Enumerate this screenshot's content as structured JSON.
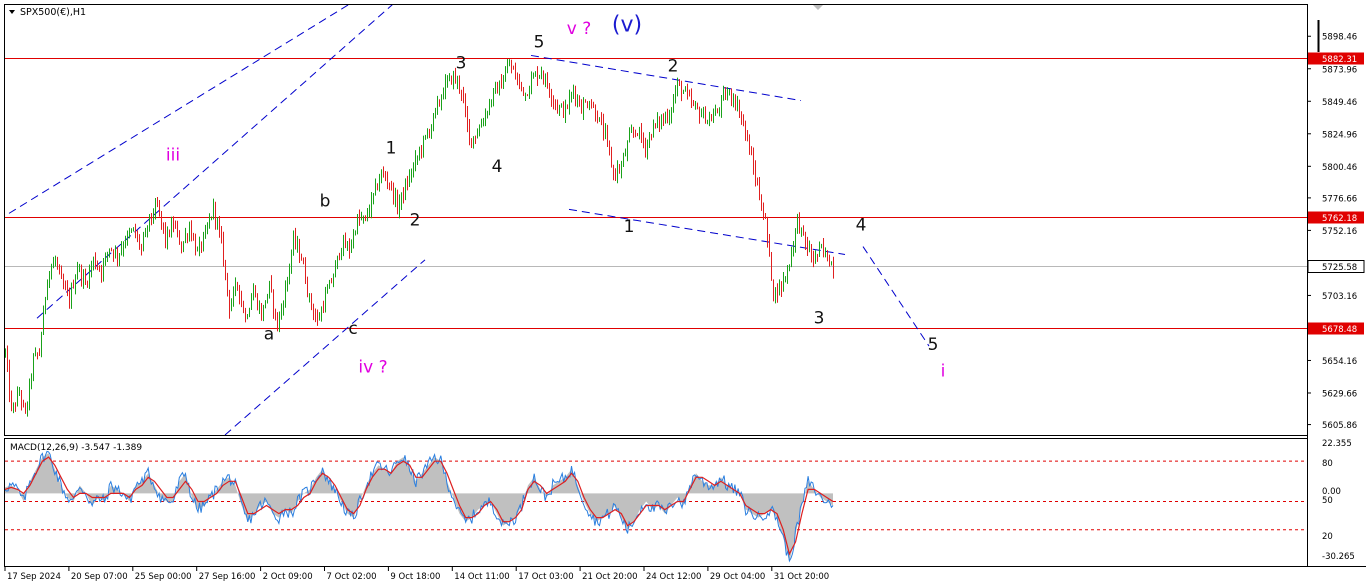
{
  "window": {
    "title": "SPX500(€),H1"
  },
  "macd": {
    "label": "MACD(12,26,9) -3.547 -1.389"
  },
  "colors": {
    "bull": "#1aa21a",
    "bear": "#e02020",
    "hline": "#e00000",
    "trend": "#0000cc",
    "label_black": "#111111",
    "label_magenta": "#e000e0",
    "label_blue": "#1a1ad0",
    "macd_hist": "#c0c0c0",
    "macd_line": "#2a7fe0",
    "macd_signal": "#dd2020",
    "price_tag_bg": "#dddddd"
  },
  "chart_data": [
    {
      "type": "candlestick",
      "title": "SPX500(€),H1",
      "ylim": [
        5598,
        5922
      ],
      "price_ticks": [
        "5898.46",
        "5873.96",
        "5849.46",
        "5824.96",
        "5800.46",
        "5776.66",
        "5752.16",
        "5725.58",
        "5703.16",
        "5678.48",
        "5654.16",
        "5629.66",
        "5605.86"
      ],
      "time_ticks": [
        "17 Sep 2024",
        "20 Sep 07:00",
        "25 Sep 00:00",
        "27 Sep 16:00",
        "2 Oct 09:00",
        "7 Oct 02:00",
        "9 Oct 18:00",
        "14 Oct 11:00",
        "17 Oct 03:00",
        "21 Oct 20:00",
        "24 Oct 12:00",
        "29 Oct 04:00",
        "31 Oct 20:00"
      ],
      "price_axis_labels": [
        "5898.46",
        "5873.96",
        "5849.46",
        "5824.96",
        "5800.46",
        "5776.66",
        "5752.16",
        "5703.16",
        "5654.16",
        "5629.66",
        "5605.86"
      ],
      "horizontal_levels": [
        {
          "price": 5882.31,
          "label": "5882.31"
        },
        {
          "price": 5762.18,
          "label": "5762.18"
        },
        {
          "price": 5678.48,
          "label": "5678.48"
        }
      ],
      "current_price": {
        "price": 5725.58,
        "label": "5725.58"
      },
      "price_path": [
        [
          0,
          5660
        ],
        [
          3,
          5615
        ],
        [
          7,
          5630
        ],
        [
          10,
          5612
        ],
        [
          14,
          5655
        ],
        [
          17,
          5660
        ],
        [
          21,
          5718
        ],
        [
          25,
          5730
        ],
        [
          28,
          5712
        ],
        [
          32,
          5700
        ],
        [
          36,
          5725
        ],
        [
          40,
          5712
        ],
        [
          44,
          5730
        ],
        [
          48,
          5722
        ],
        [
          52,
          5740
        ],
        [
          56,
          5733
        ],
        [
          60,
          5746
        ],
        [
          64,
          5752
        ],
        [
          68,
          5738
        ],
        [
          72,
          5760
        ],
        [
          76,
          5770
        ],
        [
          80,
          5745
        ],
        [
          84,
          5757
        ],
        [
          88,
          5740
        ],
        [
          92,
          5755
        ],
        [
          96,
          5735
        ],
        [
          100,
          5748
        ],
        [
          104,
          5770
        ],
        [
          108,
          5742
        ],
        [
          112,
          5695
        ],
        [
          116,
          5712
        ],
        [
          120,
          5686
        ],
        [
          124,
          5707
        ],
        [
          128,
          5688
        ],
        [
          132,
          5710
        ],
        [
          136,
          5680
        ],
        [
          140,
          5707
        ],
        [
          144,
          5745
        ],
        [
          148,
          5732
        ],
        [
          152,
          5700
        ],
        [
          156,
          5683
        ],
        [
          160,
          5702
        ],
        [
          164,
          5718
        ],
        [
          168,
          5742
        ],
        [
          172,
          5738
        ],
        [
          176,
          5760
        ],
        [
          180,
          5760
        ],
        [
          184,
          5778
        ],
        [
          188,
          5795
        ],
        [
          192,
          5788
        ],
        [
          196,
          5770
        ],
        [
          200,
          5784
        ],
        [
          204,
          5800
        ],
        [
          208,
          5815
        ],
        [
          212,
          5828
        ],
        [
          216,
          5845
        ],
        [
          220,
          5862
        ],
        [
          224,
          5868
        ],
        [
          228,
          5858
        ],
        [
          232,
          5820
        ],
        [
          236,
          5826
        ],
        [
          240,
          5840
        ],
        [
          244,
          5855
        ],
        [
          248,
          5863
        ],
        [
          252,
          5878
        ],
        [
          256,
          5865
        ],
        [
          260,
          5855
        ],
        [
          264,
          5868
        ],
        [
          268,
          5872
        ],
        [
          272,
          5858
        ],
        [
          276,
          5845
        ],
        [
          280,
          5842
        ],
        [
          284,
          5858
        ],
        [
          288,
          5845
        ],
        [
          292,
          5850
        ],
        [
          296,
          5838
        ],
        [
          300,
          5823
        ],
        [
          304,
          5795
        ],
        [
          308,
          5800
        ],
        [
          312,
          5822
        ],
        [
          316,
          5828
        ],
        [
          320,
          5815
        ],
        [
          324,
          5830
        ],
        [
          328,
          5835
        ],
        [
          332,
          5840
        ],
        [
          336,
          5862
        ],
        [
          340,
          5855
        ],
        [
          344,
          5845
        ],
        [
          348,
          5840
        ],
        [
          352,
          5835
        ],
        [
          356,
          5842
        ],
        [
          360,
          5855
        ],
        [
          364,
          5853
        ],
        [
          368,
          5838
        ],
        [
          372,
          5813
        ],
        [
          376,
          5785
        ],
        [
          380,
          5758
        ],
        [
          384,
          5705
        ],
        [
          388,
          5710
        ],
        [
          392,
          5728
        ],
        [
          396,
          5760
        ],
        [
          400,
          5742
        ],
        [
          404,
          5730
        ],
        [
          408,
          5738
        ],
        [
          412,
          5730
        ],
        [
          414,
          5725
        ]
      ],
      "trendlines": [
        {
          "from": [
            2,
            5765
          ],
          "to": [
            178,
            5928
          ]
        },
        {
          "from": [
            16,
            5686
          ],
          "to": [
            198,
            5928
          ]
        },
        {
          "from": [
            110,
            5598
          ],
          "to": [
            210,
            5730
          ]
        },
        {
          "from": [
            263,
            5884
          ],
          "to": [
            398,
            5850
          ]
        },
        {
          "from": [
            282,
            5768
          ],
          "to": [
            420,
            5734
          ]
        }
      ],
      "projection": [
        [
          429,
          5740
        ],
        [
          462,
          5665
        ]
      ],
      "wave_labels": [
        {
          "text": "iii",
          "bar": 84,
          "price": 5805,
          "color": "magenta"
        },
        {
          "text": "iv ?",
          "bar": 184,
          "price": 5645,
          "color": "magenta"
        },
        {
          "text": "v ?",
          "bar": 287,
          "price": 5900,
          "color": "magenta"
        },
        {
          "text": "(v)",
          "bar": 311,
          "price": 5902,
          "color": "blue"
        },
        {
          "text": "i",
          "bar": 469,
          "price": 5642,
          "color": "magenta"
        },
        {
          "text": "a",
          "bar": 132,
          "price": 5670,
          "color": "black"
        },
        {
          "text": "b",
          "bar": 160,
          "price": 5770,
          "color": "black"
        },
        {
          "text": "c",
          "bar": 174,
          "price": 5674,
          "color": "black"
        },
        {
          "text": "1",
          "bar": 193,
          "price": 5810,
          "color": "black"
        },
        {
          "text": "2",
          "bar": 205,
          "price": 5756,
          "color": "black"
        },
        {
          "text": "3",
          "bar": 228,
          "price": 5874,
          "color": "black"
        },
        {
          "text": "4",
          "bar": 246,
          "price": 5796,
          "color": "black"
        },
        {
          "text": "5",
          "bar": 267,
          "price": 5890,
          "color": "black"
        },
        {
          "text": "1",
          "bar": 312,
          "price": 5751,
          "color": "black"
        },
        {
          "text": "2",
          "bar": 334,
          "price": 5872,
          "color": "black"
        },
        {
          "text": "3",
          "bar": 407,
          "price": 5682,
          "color": "black"
        },
        {
          "text": "4",
          "bar": 428,
          "price": 5752,
          "color": "black"
        },
        {
          "text": "5",
          "bar": 464,
          "price": 5662,
          "color": "black"
        }
      ]
    },
    {
      "type": "line",
      "title": "MACD(12,26,9) -3.547 -1.389",
      "ylim": [
        -36,
        27
      ],
      "level_labels": [
        "22.355",
        "80",
        "0.00",
        "50",
        "20",
        "-30.265"
      ],
      "dashed_levels": [
        16,
        -4,
        -18
      ],
      "series": [
        {
          "name": "MACD",
          "values": [
            3,
            4,
            2,
            -4,
            6,
            12,
            18,
            20,
            12,
            4,
            -2,
            -4,
            4,
            0,
            -6,
            -2,
            -4,
            4,
            2,
            0,
            -4,
            4,
            6,
            10,
            4,
            -2,
            -4,
            -4,
            6,
            10,
            -2,
            -8,
            -6,
            -2,
            2,
            6,
            8,
            4,
            -6,
            -14,
            -10,
            -6,
            -4,
            -10,
            -12,
            -8,
            -10,
            -4,
            0,
            2,
            8,
            12,
            6,
            2,
            -4,
            -10,
            -12,
            -4,
            4,
            10,
            14,
            12,
            10,
            16,
            18,
            12,
            6,
            10,
            14,
            18,
            16,
            6,
            -2,
            -10,
            -14,
            -12,
            -8,
            -6,
            -4,
            -10,
            -16,
            -14,
            -12,
            -6,
            4,
            8,
            2,
            -2,
            4,
            6,
            8,
            12,
            4,
            -4,
            -10,
            -14,
            -12,
            -10,
            -6,
            -12,
            -18,
            -14,
            -8,
            -4,
            -8,
            -6,
            -10,
            -6,
            -2,
            -6,
            4,
            10,
            6,
            4,
            4,
            8,
            4,
            2,
            0,
            -8,
            -10,
            -12,
            -10,
            -8,
            -12,
            -22,
            -34,
            -20,
            -6,
            6,
            2,
            -2,
            -4,
            -6
          ]
        },
        {
          "name": "Signal",
          "values": [
            2,
            3,
            2,
            0,
            4,
            10,
            16,
            18,
            14,
            8,
            2,
            -2,
            0,
            0,
            -2,
            -2,
            -2,
            0,
            0,
            0,
            -2,
            2,
            4,
            8,
            6,
            2,
            -2,
            -2,
            2,
            6,
            2,
            -4,
            -4,
            -2,
            0,
            4,
            6,
            6,
            -2,
            -10,
            -10,
            -8,
            -6,
            -8,
            -10,
            -8,
            -8,
            -6,
            -2,
            0,
            6,
            10,
            8,
            4,
            -2,
            -8,
            -10,
            -6,
            2,
            8,
            12,
            12,
            10,
            14,
            16,
            14,
            8,
            8,
            12,
            16,
            16,
            10,
            2,
            -6,
            -12,
            -12,
            -10,
            -6,
            -4,
            -8,
            -14,
            -14,
            -12,
            -8,
            2,
            6,
            4,
            0,
            2,
            4,
            6,
            10,
            6,
            -2,
            -8,
            -12,
            -12,
            -10,
            -8,
            -10,
            -16,
            -14,
            -10,
            -6,
            -6,
            -6,
            -8,
            -6,
            -4,
            -4,
            2,
            8,
            8,
            6,
            4,
            6,
            4,
            2,
            0,
            -6,
            -8,
            -10,
            -10,
            -8,
            -10,
            -18,
            -30,
            -24,
            -10,
            2,
            2,
            0,
            -2,
            -4
          ]
        }
      ]
    }
  ]
}
